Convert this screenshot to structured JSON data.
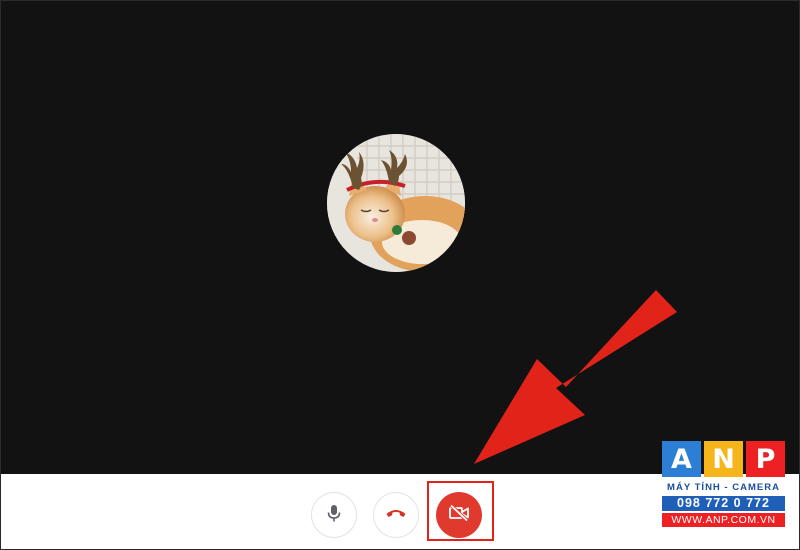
{
  "call": {
    "avatar": "cat-with-reindeer-antlers-headband",
    "controls": [
      {
        "id": "mic",
        "icon": "microphone-icon"
      },
      {
        "id": "end",
        "icon": "phone-hangup-icon",
        "color": "#d93025"
      },
      {
        "id": "camera",
        "icon": "video-off-icon",
        "color": "#e03a2f",
        "state": "off"
      }
    ]
  },
  "annotation": {
    "arrow_color": "#e2231a",
    "highlight_color": "#e2231a"
  },
  "watermark": {
    "letters": [
      "A",
      "N",
      "P"
    ],
    "tile_colors": [
      "#2c7fd4",
      "#f7b51c",
      "#ed2124"
    ],
    "tagline": "MÁY TÍNH - CAMERA",
    "phone": "098 772 0 772",
    "website": "WWW.ANP.COM.VN"
  }
}
